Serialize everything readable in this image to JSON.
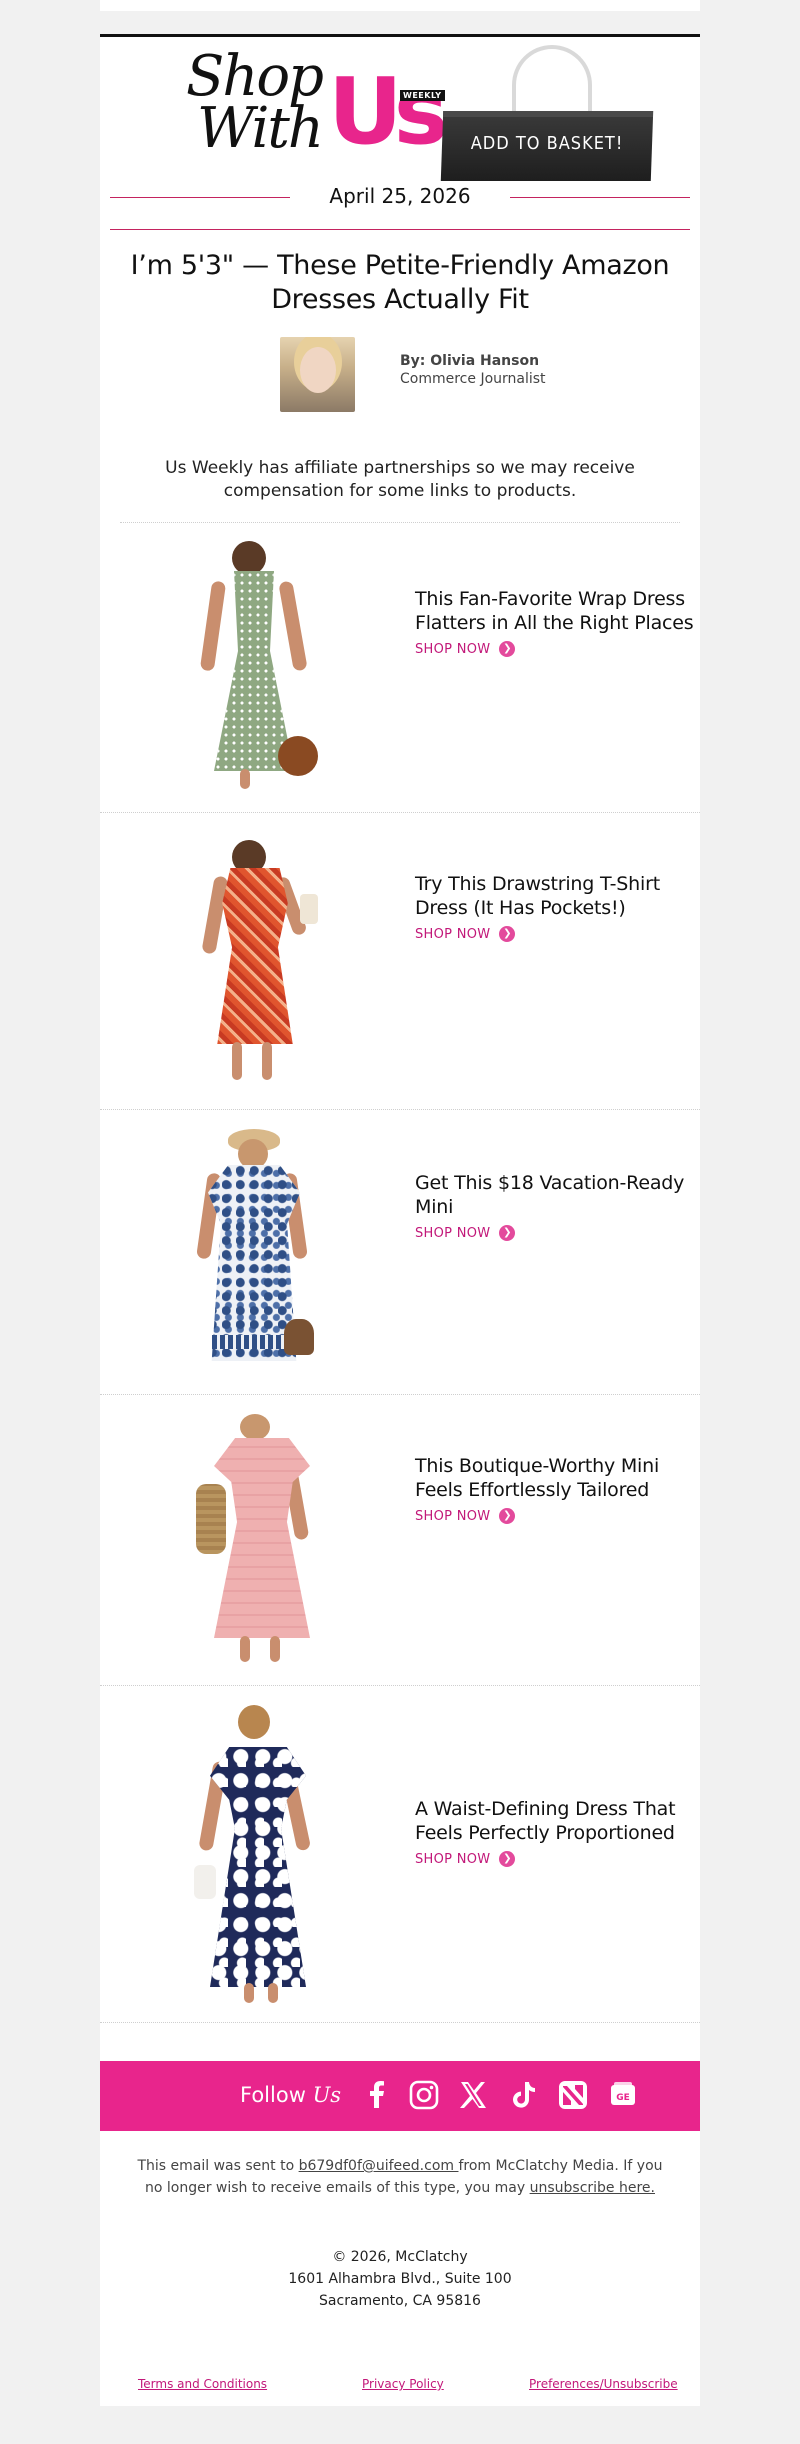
{
  "header": {
    "brand_shop_line1": "Shop",
    "brand_shop_line2": "With",
    "brand_us": "Us",
    "brand_weekly": "WEEKLY",
    "basket_label": "ADD TO BASKET!",
    "date": "April 25, 2026"
  },
  "article": {
    "headline": "I’m 5'3\" — These Petite-Friendly Amazon Dresses Actually Fit",
    "author_name": "By: Olivia Hanson",
    "author_role": "Commerce Journalist",
    "disclosure": "Us Weekly has affiliate partnerships so we may receive compensation for some links to products."
  },
  "products": [
    {
      "title": "This Fan-Favorite Wrap Dress Flatters in All the Right Places",
      "cta": "SHOP NOW"
    },
    {
      "title": "Try This Drawstring T-Shirt Dress (It Has Pockets!)",
      "cta": "SHOP NOW"
    },
    {
      "title": "Get This $18 Vacation-Ready Mini",
      "cta": "SHOP NOW"
    },
    {
      "title": "This Boutique-Worthy Mini Feels Effortlessly Tailored",
      "cta": "SHOP NOW"
    },
    {
      "title": "A Waist-Defining Dress That Feels Perfectly Proportioned",
      "cta": "SHOP NOW"
    }
  ],
  "follow": {
    "label": "Follow",
    "label_us": "Us",
    "icons": [
      "facebook-icon",
      "instagram-icon",
      "x-icon",
      "tiktok-icon",
      "apple-news-icon",
      "google-news-icon"
    ]
  },
  "footer": {
    "sent_prefix": "This email was sent to ",
    "email": "b679df0f@uifeed.com ",
    "sent_mid": "from McClatchy Media. If you no longer wish to receive emails of this type, you may ",
    "unsubscribe": "unsubscribe here.",
    "copyright": "© 2026, McClatchy",
    "address1": "1601 Alhambra Blvd., Suite 100",
    "address2": "Sacramento, CA 95816",
    "links": {
      "terms": "Terms and Conditions",
      "privacy": "Privacy Policy",
      "prefs": "Preferences/Unsubscribe"
    }
  },
  "colors": {
    "accent": "#e8258c",
    "link": "#c21879",
    "rule": "#c4235f"
  }
}
